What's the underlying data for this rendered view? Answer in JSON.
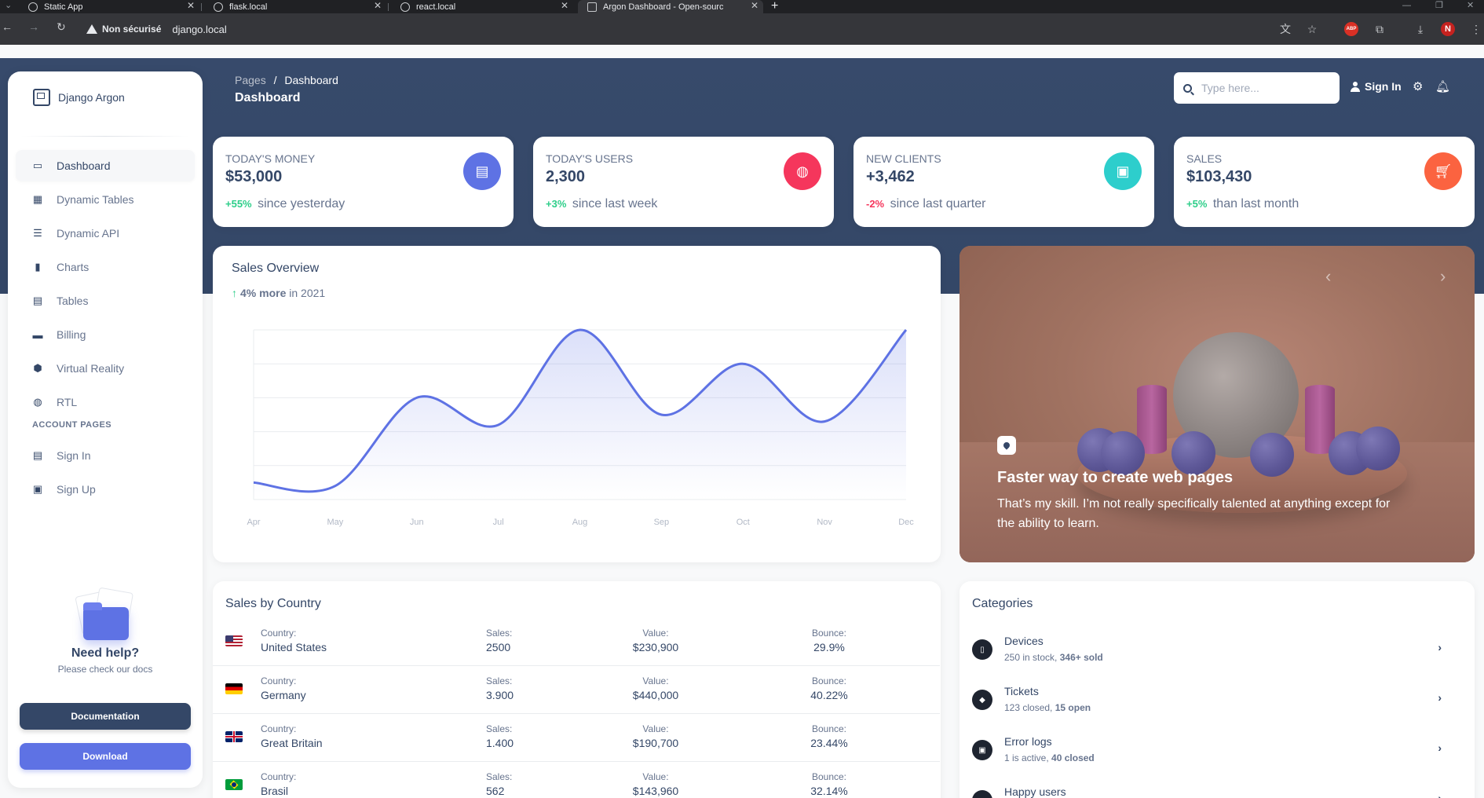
{
  "browser": {
    "tabs": [
      {
        "title": "Static App"
      },
      {
        "title": "flask.local"
      },
      {
        "title": "react.local"
      },
      {
        "title": "Argon Dashboard - Open-sourc"
      }
    ],
    "security_label": "Non sécurisé",
    "url": "django.local",
    "profile_initial": "N",
    "adblock_label": "ABP"
  },
  "sidebar": {
    "brand": "Django Argon",
    "items": [
      {
        "label": "Dashboard",
        "icon": "monitor-icon"
      },
      {
        "label": "Dynamic Tables",
        "icon": "table-icon"
      },
      {
        "label": "Dynamic API",
        "icon": "api-icon"
      },
      {
        "label": "Charts",
        "icon": "bar-chart-icon"
      },
      {
        "label": "Tables",
        "icon": "calendar-grid-icon"
      },
      {
        "label": "Billing",
        "icon": "credit-card-icon"
      },
      {
        "label": "Virtual Reality",
        "icon": "cube-icon"
      },
      {
        "label": "RTL",
        "icon": "globe-icon"
      }
    ],
    "section_label": "ACCOUNT PAGES",
    "account_items": [
      {
        "label": "Sign In",
        "icon": "document-icon"
      },
      {
        "label": "Sign Up",
        "icon": "document-plus-icon"
      }
    ],
    "help": {
      "title": "Need help?",
      "subtitle": "Please check our docs",
      "doc_button": "Documentation",
      "download_button": "Download"
    }
  },
  "header": {
    "breadcrumb_root": "Pages",
    "breadcrumb_sep": "/",
    "breadcrumb_current": "Dashboard",
    "title": "Dashboard",
    "search_placeholder": "Type here...",
    "signin_label": "Sign In"
  },
  "stats": [
    {
      "label": "Today's Money",
      "value": "$53,000",
      "pct": "+55%",
      "note": "since yesterday",
      "pct_color": "#2dce89",
      "icon_bg": "#5e72e4",
      "icon": "money-icon"
    },
    {
      "label": "Today's Users",
      "value": "2,300",
      "pct": "+3%",
      "note": "since last week",
      "pct_color": "#2dce89",
      "icon_bg": "#f5365c",
      "icon": "globe-icon"
    },
    {
      "label": "New Clients",
      "value": "+3,462",
      "pct": "-2%",
      "note": "since last quarter",
      "pct_color": "#f5365c",
      "icon_bg": "#2dcecc",
      "icon": "paper-icon"
    },
    {
      "label": "Sales",
      "value": "$103,430",
      "pct": "+5%",
      "note": "than last month",
      "pct_color": "#2dce89",
      "icon_bg": "#fb6340",
      "icon": "cart-icon"
    }
  ],
  "sales_overview": {
    "title": "Sales Overview",
    "sub_strong": "4% more",
    "sub_rest": "in 2021"
  },
  "chart_data": {
    "type": "area",
    "title": "Sales Overview",
    "categories": [
      "Apr",
      "May",
      "Jun",
      "Jul",
      "Aug",
      "Sep",
      "Oct",
      "Nov",
      "Dec"
    ],
    "series": [
      {
        "values": [
          50,
          40,
          300,
          220,
          500,
          250,
          400,
          230,
          500
        ]
      }
    ],
    "ylim": [
      0,
      500
    ],
    "grid": true,
    "color": "#5e72e4"
  },
  "carousel": {
    "title": "Faster way to create web pages",
    "text": "That’s my skill. I’m not really specifically talented at anything except for the ability to learn."
  },
  "sales_by_country": {
    "title": "Sales by Country",
    "labels": {
      "country": "Country:",
      "sales": "Sales:",
      "value": "Value:",
      "bounce": "Bounce:"
    },
    "rows": [
      {
        "country": "United States",
        "sales": "2500",
        "value": "$230,900",
        "bounce": "29.9%",
        "flag": "us"
      },
      {
        "country": "Germany",
        "sales": "3.900",
        "value": "$440,000",
        "bounce": "40.22%",
        "flag": "de"
      },
      {
        "country": "Great Britain",
        "sales": "1.400",
        "value": "$190,700",
        "bounce": "23.44%",
        "flag": "gb"
      },
      {
        "country": "Brasil",
        "sales": "562",
        "value": "$143,960",
        "bounce": "32.14%",
        "flag": "br"
      }
    ]
  },
  "categories": {
    "title": "Categories",
    "items": [
      {
        "name": "Devices",
        "desc_a": "250 in stock,",
        "desc_b": "346+ sold",
        "icon": "mobile-icon"
      },
      {
        "name": "Tickets",
        "desc_a": "123 closed,",
        "desc_b": "15 open",
        "icon": "tag-icon"
      },
      {
        "name": "Error logs",
        "desc_a": "1 is active,",
        "desc_b": "40 closed",
        "icon": "box-icon"
      },
      {
        "name": "Happy users",
        "desc_a": "",
        "desc_b": "",
        "icon": "smile-icon"
      }
    ]
  }
}
